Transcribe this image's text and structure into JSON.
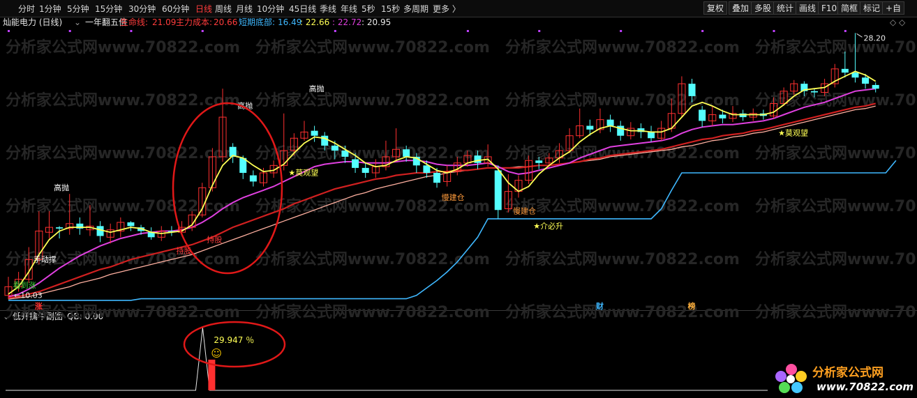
{
  "toolbar": {
    "periods": [
      "分时",
      "1分钟",
      "5分钟",
      "15分钟",
      "30分钟",
      "60分钟",
      "日线",
      "周线",
      "月线",
      "10分钟",
      "45日线",
      "季线",
      "年线",
      "5秒",
      "15秒",
      "多周期",
      "更多 〉"
    ],
    "active_index": 6,
    "right_buttons": [
      "复权",
      "叠加",
      "多股",
      "统计",
      "画线",
      "F10",
      "简框",
      "标记",
      "+自"
    ]
  },
  "info": {
    "stock_name": "灿能电力 (日线)",
    "formula": "一年翻五倍",
    "life_label": "生命线: ",
    "life_value": "21.09",
    "main_label": "主力成本: ",
    "main_value": "20.66",
    "short_label": "短期底部: ",
    "short_value": "16.49",
    "v1": ": 22.66",
    "v2": ": 22.72",
    "v3": ": 20.95",
    "diamond_icons": "◇ ◇"
  },
  "sub": {
    "title": "低开擒牛副图",
    "qb": "QB: 0.00",
    "percent_label": "29.947 ％",
    "smiley": "☺"
  },
  "watermark": "分析家公式网www.70822.com",
  "logo": {
    "title": "分析家公式网",
    "url": "www.70822.com"
  },
  "colors": {
    "up": "#ff3030",
    "down": "#54ffff",
    "ma_yellow": "#ffff55",
    "ma_magenta": "#e040e0",
    "ma_red": "#d02020",
    "ma_pink": "#ffb0a0",
    "bottom_line": "#3fb8ff",
    "circle": "#e01818"
  },
  "chart_data": {
    "type": "candlestick",
    "title": "灿能电力 (日线)",
    "price_markers": {
      "high_label": "28.20",
      "low_label": "10.03"
    },
    "candles": [
      {
        "o": 10.3,
        "c": 11.0,
        "h": 11.8,
        "l": 10.0
      },
      {
        "o": 11.0,
        "c": 11.6,
        "h": 12.2,
        "l": 10.6
      },
      {
        "o": 11.6,
        "c": 13.2,
        "h": 14.2,
        "l": 11.3
      },
      {
        "o": 13.2,
        "c": 15.5,
        "h": 17.1,
        "l": 12.8
      },
      {
        "o": 15.4,
        "c": 15.8,
        "h": 17.1,
        "l": 14.9
      },
      {
        "o": 15.8,
        "c": 15.7,
        "h": 15.9,
        "l": 14.9
      },
      {
        "o": 15.7,
        "c": 16.1,
        "h": 18.5,
        "l": 15.2
      },
      {
        "o": 16.1,
        "c": 15.7,
        "h": 16.6,
        "l": 15.2
      },
      {
        "o": 15.6,
        "c": 15.9,
        "h": 17.6,
        "l": 15.1
      },
      {
        "o": 15.9,
        "c": 15.1,
        "h": 16.3,
        "l": 14.6
      },
      {
        "o": 15.0,
        "c": 15.6,
        "h": 16.1,
        "l": 14.5
      },
      {
        "o": 15.5,
        "c": 16.2,
        "h": 16.6,
        "l": 15.0
      },
      {
        "o": 16.2,
        "c": 15.9,
        "h": 16.3,
        "l": 15.5
      },
      {
        "o": 15.8,
        "c": 15.5,
        "h": 16.0,
        "l": 15.2
      },
      {
        "o": 15.4,
        "c": 15.0,
        "h": 15.8,
        "l": 14.8
      },
      {
        "o": 15.0,
        "c": 15.5,
        "h": 15.9,
        "l": 14.7
      },
      {
        "o": 15.5,
        "c": 15.4,
        "h": 15.9,
        "l": 15.1
      },
      {
        "o": 15.4,
        "c": 15.8,
        "h": 16.3,
        "l": 15.1
      },
      {
        "o": 15.8,
        "c": 16.8,
        "h": 17.1,
        "l": 15.5
      },
      {
        "o": 16.8,
        "c": 19.0,
        "h": 19.4,
        "l": 16.6
      },
      {
        "o": 19.0,
        "c": 21.5,
        "h": 22.2,
        "l": 18.7
      },
      {
        "o": 21.5,
        "c": 24.7,
        "h": 27.0,
        "l": 21.1
      },
      {
        "o": 22.3,
        "c": 21.5,
        "h": 22.6,
        "l": 21.0
      },
      {
        "o": 21.4,
        "c": 20.2,
        "h": 21.6,
        "l": 19.7
      },
      {
        "o": 20.0,
        "c": 19.5,
        "h": 20.4,
        "l": 19.1
      },
      {
        "o": 19.4,
        "c": 20.2,
        "h": 20.6,
        "l": 19.1
      },
      {
        "o": 20.2,
        "c": 20.8,
        "h": 21.2,
        "l": 19.8
      },
      {
        "o": 20.8,
        "c": 22.0,
        "h": 25.0,
        "l": 20.4
      },
      {
        "o": 22.0,
        "c": 23.0,
        "h": 23.4,
        "l": 21.6
      },
      {
        "o": 23.0,
        "c": 23.5,
        "h": 24.4,
        "l": 22.8
      },
      {
        "o": 23.6,
        "c": 23.2,
        "h": 24.0,
        "l": 22.7
      },
      {
        "o": 23.2,
        "c": 22.4,
        "h": 23.5,
        "l": 22.0
      },
      {
        "o": 22.4,
        "c": 22.0,
        "h": 22.8,
        "l": 21.3
      },
      {
        "o": 22.0,
        "c": 21.5,
        "h": 22.4,
        "l": 21.0
      },
      {
        "o": 21.3,
        "c": 20.6,
        "h": 21.8,
        "l": 20.2
      },
      {
        "o": 20.6,
        "c": 20.2,
        "h": 21.0,
        "l": 19.8
      },
      {
        "o": 20.2,
        "c": 20.7,
        "h": 21.3,
        "l": 19.8
      },
      {
        "o": 20.7,
        "c": 21.5,
        "h": 22.8,
        "l": 20.4
      },
      {
        "o": 21.5,
        "c": 22.1,
        "h": 23.8,
        "l": 21.1
      },
      {
        "o": 22.1,
        "c": 21.5,
        "h": 22.4,
        "l": 21.1
      },
      {
        "o": 21.5,
        "c": 20.8,
        "h": 21.8,
        "l": 20.2
      },
      {
        "o": 20.8,
        "c": 20.2,
        "h": 21.2,
        "l": 19.8
      },
      {
        "o": 20.2,
        "c": 19.4,
        "h": 20.6,
        "l": 19.0
      },
      {
        "o": 19.5,
        "c": 20.3,
        "h": 20.8,
        "l": 19.1
      },
      {
        "o": 20.3,
        "c": 21.0,
        "h": 21.5,
        "l": 20.0
      },
      {
        "o": 21.0,
        "c": 21.6,
        "h": 22.0,
        "l": 20.7
      },
      {
        "o": 21.6,
        "c": 21.0,
        "h": 22.0,
        "l": 20.5
      },
      {
        "o": 21.0,
        "c": 21.5,
        "h": 22.5,
        "l": 20.7
      },
      {
        "o": 20.4,
        "c": 17.2,
        "h": 20.8,
        "l": 16.5
      },
      {
        "o": 17.3,
        "c": 18.7,
        "h": 20.1,
        "l": 17.0
      },
      {
        "o": 18.7,
        "c": 19.6,
        "h": 20.0,
        "l": 18.2
      },
      {
        "o": 19.6,
        "c": 21.2,
        "h": 21.6,
        "l": 19.3
      },
      {
        "o": 21.2,
        "c": 21.0,
        "h": 21.5,
        "l": 20.5
      },
      {
        "o": 21.0,
        "c": 21.4,
        "h": 21.8,
        "l": 20.7
      },
      {
        "o": 21.4,
        "c": 22.0,
        "h": 22.6,
        "l": 21.0
      },
      {
        "o": 22.0,
        "c": 23.2,
        "h": 23.8,
        "l": 21.8
      },
      {
        "o": 23.2,
        "c": 24.0,
        "h": 25.4,
        "l": 23.0
      },
      {
        "o": 24.0,
        "c": 23.7,
        "h": 24.5,
        "l": 23.2
      },
      {
        "o": 23.7,
        "c": 24.5,
        "h": 25.4,
        "l": 23.4
      },
      {
        "o": 24.5,
        "c": 24.0,
        "h": 24.9,
        "l": 23.5
      },
      {
        "o": 24.0,
        "c": 23.2,
        "h": 24.4,
        "l": 22.8
      },
      {
        "o": 23.2,
        "c": 23.8,
        "h": 24.3,
        "l": 22.9
      },
      {
        "o": 23.8,
        "c": 23.5,
        "h": 24.2,
        "l": 23.0
      },
      {
        "o": 23.5,
        "c": 23.0,
        "h": 24.0,
        "l": 22.7
      },
      {
        "o": 23.0,
        "c": 23.8,
        "h": 24.4,
        "l": 22.8
      },
      {
        "o": 23.8,
        "c": 25.0,
        "h": 26.2,
        "l": 23.5
      },
      {
        "o": 25.0,
        "c": 27.4,
        "h": 28.0,
        "l": 24.7
      },
      {
        "o": 27.4,
        "c": 26.4,
        "h": 27.8,
        "l": 25.9
      },
      {
        "o": 25.3,
        "c": 24.4,
        "h": 25.6,
        "l": 23.9
      },
      {
        "o": 24.4,
        "c": 24.9,
        "h": 25.6,
        "l": 24.0
      },
      {
        "o": 24.9,
        "c": 24.6,
        "h": 25.3,
        "l": 24.2
      },
      {
        "o": 24.6,
        "c": 25.0,
        "h": 25.6,
        "l": 24.3
      },
      {
        "o": 25.0,
        "c": 24.7,
        "h": 25.3,
        "l": 24.4
      },
      {
        "o": 24.7,
        "c": 25.0,
        "h": 25.4,
        "l": 24.4
      },
      {
        "o": 25.0,
        "c": 24.8,
        "h": 25.3,
        "l": 24.5
      },
      {
        "o": 24.8,
        "c": 25.8,
        "h": 26.3,
        "l": 24.6
      },
      {
        "o": 25.8,
        "c": 26.8,
        "h": 27.1,
        "l": 25.6
      },
      {
        "o": 26.8,
        "c": 27.4,
        "h": 27.7,
        "l": 26.5
      },
      {
        "o": 27.4,
        "c": 26.8,
        "h": 27.6,
        "l": 26.4
      },
      {
        "o": 26.8,
        "c": 26.7,
        "h": 27.0,
        "l": 26.3
      },
      {
        "o": 26.7,
        "c": 27.4,
        "h": 27.8,
        "l": 26.4
      },
      {
        "o": 27.4,
        "c": 28.6,
        "h": 29.0,
        "l": 27.1
      },
      {
        "o": 28.6,
        "c": 28.3,
        "h": 30.0,
        "l": 27.9
      },
      {
        "o": 28.3,
        "c": 27.9,
        "h": 31.5,
        "l": 27.5
      },
      {
        "o": 27.9,
        "c": 27.4,
        "h": 28.2,
        "l": 27.0
      },
      {
        "o": 27.3,
        "c": 27.0,
        "h": 27.5,
        "l": 26.7
      }
    ],
    "ma_yellow": [
      10.4,
      11.0,
      12.2,
      13.6,
      14.8,
      15.5,
      15.8,
      15.8,
      15.8,
      15.6,
      15.4,
      15.6,
      15.8,
      15.7,
      15.4,
      15.3,
      15.4,
      15.5,
      16.0,
      17.3,
      19.2,
      20.8,
      21.6,
      21.4,
      20.8,
      20.3,
      20.4,
      20.9,
      21.8,
      22.6,
      23.1,
      23.0,
      22.6,
      22.1,
      21.6,
      21.0,
      20.7,
      20.8,
      21.2,
      21.5,
      21.4,
      20.9,
      20.4,
      20.2,
      20.5,
      21.0,
      21.2,
      21.3,
      20.5,
      19.4,
      18.7,
      19.1,
      20.1,
      20.8,
      21.4,
      21.9,
      22.7,
      23.3,
      23.8,
      24.0,
      23.8,
      23.6,
      23.6,
      23.5,
      23.5,
      23.8,
      24.7,
      25.6,
      25.9,
      25.6,
      25.2,
      24.9,
      24.9,
      24.9,
      24.9,
      25.1,
      25.7,
      26.4,
      26.9,
      27.0,
      27.1,
      27.6,
      28.0,
      28.4,
      28.1,
      27.6
    ],
    "ma_magenta": [
      10.2,
      10.4,
      10.8,
      11.3,
      11.9,
      12.5,
      13.0,
      13.5,
      13.9,
      14.3,
      14.6,
      14.9,
      15.1,
      15.3,
      15.4,
      15.5,
      15.5,
      15.6,
      15.8,
      16.2,
      16.7,
      17.3,
      17.8,
      18.2,
      18.5,
      18.8,
      19.1,
      19.5,
      19.9,
      20.3,
      20.7,
      20.9,
      21.0,
      21.1,
      21.1,
      21.0,
      21.0,
      21.0,
      21.1,
      21.2,
      21.2,
      21.1,
      20.9,
      20.8,
      20.8,
      20.8,
      20.9,
      21.0,
      20.7,
      20.3,
      20.1,
      20.2,
      20.4,
      20.6,
      20.8,
      21.0,
      21.4,
      21.7,
      22.0,
      22.3,
      22.4,
      22.5,
      22.6,
      22.7,
      22.8,
      23.0,
      23.4,
      23.7,
      23.9,
      24.0,
      24.1,
      24.1,
      24.2,
      24.3,
      24.4,
      24.6,
      24.9,
      25.2,
      25.5,
      25.7,
      25.9,
      26.2,
      26.5,
      26.8,
      26.9,
      27.0
    ],
    "ma_red": [
      10.1,
      10.2,
      10.4,
      10.6,
      10.9,
      11.2,
      11.5,
      11.8,
      12.1,
      12.4,
      12.6,
      12.9,
      13.2,
      13.4,
      13.6,
      13.8,
      14.0,
      14.2,
      14.4,
      14.7,
      15.0,
      15.4,
      15.8,
      16.1,
      16.4,
      16.7,
      17.0,
      17.3,
      17.7,
      18.0,
      18.3,
      18.6,
      18.9,
      19.1,
      19.3,
      19.5,
      19.7,
      19.8,
      20.0,
      20.1,
      20.2,
      20.2,
      20.3,
      20.3,
      20.4,
      20.4,
      20.5,
      20.6,
      20.6,
      20.6,
      20.6,
      20.7,
      20.8,
      20.8,
      20.9,
      21.0,
      21.1,
      21.3,
      21.4,
      21.6,
      21.7,
      21.8,
      21.9,
      22.0,
      22.1,
      22.3,
      22.5,
      22.7,
      22.9,
      23.0,
      23.2,
      23.3,
      23.4,
      23.6,
      23.7,
      23.9,
      24.1,
      24.3,
      24.5,
      24.7,
      24.9,
      25.1,
      25.3,
      25.5,
      25.6,
      25.8
    ],
    "ma_pink": [
      10.0,
      10.1,
      10.2,
      10.4,
      10.6,
      10.8,
      11.0,
      11.3,
      11.5,
      11.7,
      12.0,
      12.2,
      12.4,
      12.6,
      12.8,
      13.0,
      13.2,
      13.4,
      13.6,
      13.9,
      14.2,
      14.5,
      14.8,
      15.1,
      15.4,
      15.7,
      16.0,
      16.3,
      16.6,
      16.9,
      17.2,
      17.5,
      17.8,
      18.1,
      18.4,
      18.6,
      18.9,
      19.1,
      19.3,
      19.5,
      19.7,
      19.9,
      20.0,
      20.2,
      20.3,
      20.4,
      20.5,
      20.6,
      20.6,
      20.6,
      20.7,
      20.7,
      20.8,
      20.8,
      20.9,
      21.0,
      21.1,
      21.2,
      21.3,
      21.5,
      21.6,
      21.7,
      21.8,
      21.9,
      22.0,
      22.1,
      22.3,
      22.4,
      22.6,
      22.8,
      22.9,
      23.1,
      23.2,
      23.4,
      23.5,
      23.7,
      23.9,
      24.1,
      24.3,
      24.5,
      24.7,
      24.9,
      25.1,
      25.3,
      25.4,
      25.6
    ],
    "bottom_line": [
      9.9,
      9.9,
      9.9,
      9.9,
      9.9,
      9.9,
      9.9,
      9.9,
      9.9,
      9.9,
      9.9,
      9.9,
      9.9,
      10.03,
      10.03,
      10.03,
      10.03,
      10.03,
      10.03,
      10.03,
      10.03,
      10.03,
      10.03,
      10.03,
      10.03,
      10.03,
      10.03,
      10.03,
      10.03,
      10.03,
      10.03,
      10.03,
      10.03,
      10.03,
      10.03,
      10.03,
      10.03,
      10.03,
      10.03,
      10.03,
      10.3,
      10.9,
      11.5,
      12.2,
      13.0,
      14.0,
      15.0,
      16.49,
      16.49,
      16.49,
      16.49,
      16.49,
      16.49,
      16.49,
      16.49,
      16.49,
      16.49,
      16.49,
      16.49,
      16.49,
      16.49,
      16.49,
      16.49,
      16.49,
      17.3,
      18.8,
      20.2,
      20.2,
      20.2,
      20.2,
      20.2,
      20.2,
      20.2,
      20.2,
      20.2,
      20.2,
      20.2,
      20.2,
      20.2,
      20.2,
      20.2,
      20.2,
      20.2,
      20.2,
      20.2,
      20.2,
      20.2,
      21.2
    ],
    "annotations": [
      {
        "i": 1,
        "text": "看到涨",
        "price": 10.9,
        "color": "#3cd23c"
      },
      {
        "i": 3,
        "text": "手动撑",
        "price": 13.0,
        "color": "#ffffff"
      },
      {
        "i": 5,
        "text": "高抛",
        "price": 18.8,
        "color": "#ffffff"
      },
      {
        "i": 17,
        "text": "持股",
        "price": 13.7,
        "color": "#ff3c3c"
      },
      {
        "i": 20,
        "text": "持股",
        "price": 14.6,
        "color": "#ff3c3c"
      },
      {
        "i": 23,
        "text": "高抛",
        "price": 25.4,
        "color": "#ffffff"
      },
      {
        "i": 30,
        "text": "高抛",
        "price": 26.8,
        "color": "#ffffff"
      },
      {
        "i": 28,
        "text": "★莫观望",
        "price": 20.0,
        "color": "#ffff55"
      },
      {
        "i": 43,
        "text": "慢建仓",
        "price": 18.0,
        "color": "#ff9b3c"
      },
      {
        "i": 50,
        "text": "慢建仓",
        "price": 16.9,
        "color": "#ff9b3c"
      },
      {
        "i": 52,
        "text": "★介必升",
        "price": 15.7,
        "color": "#ffff55"
      },
      {
        "i": 76,
        "text": "★莫观望",
        "price": 23.2,
        "color": "#ffff55"
      }
    ],
    "bottom_markers": [
      {
        "i": 3,
        "text": "涨",
        "color": "#ff3030"
      },
      {
        "i": 58,
        "text": "财",
        "color": "#3fb8ff"
      },
      {
        "i": 67,
        "text": "榜",
        "color": "#ffb03c"
      }
    ],
    "sub_indicator": {
      "signal_index": 20,
      "value": 29.947,
      "qb": 0.0
    }
  }
}
